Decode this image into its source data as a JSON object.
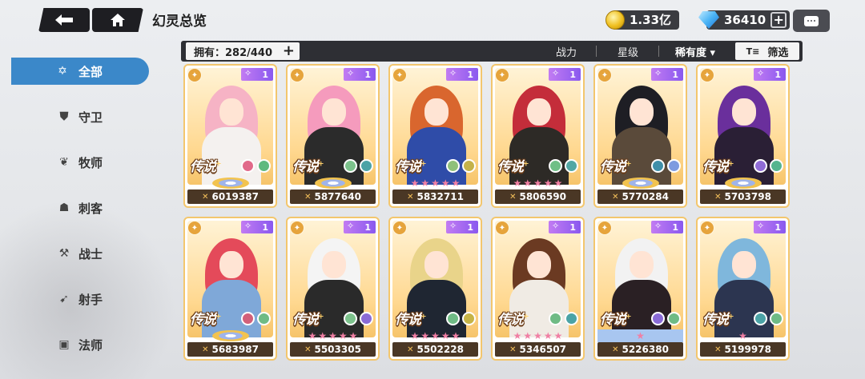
{
  "header": {
    "title": "幻灵总览",
    "back_icon": "back-arrow-icon",
    "home_icon": "home-icon",
    "gold": "1.33亿",
    "gems": "36410",
    "chat_icon": "chat-icon"
  },
  "sidebar": {
    "items": [
      {
        "label": "全部",
        "icon": "all-icon",
        "active": true
      },
      {
        "label": "守卫",
        "icon": "guard-icon"
      },
      {
        "label": "牧师",
        "icon": "priest-icon"
      },
      {
        "label": "刺客",
        "icon": "assassin-icon"
      },
      {
        "label": "战士",
        "icon": "warrior-icon"
      },
      {
        "label": "射手",
        "icon": "archer-icon"
      },
      {
        "label": "法师",
        "icon": "mage-icon"
      }
    ]
  },
  "filterbar": {
    "owned": "拥有：282/440",
    "sort_power": "战力",
    "sort_star": "星级",
    "sort_rarity": "稀有度 ▾",
    "filter_label": "筛选"
  },
  "cards": [
    {
      "level": "1",
      "rarity": "传说",
      "power": "6019387",
      "stars": "wings",
      "hair": "#f6b3c5",
      "body": "#f4f1ef"
    },
    {
      "level": "1",
      "rarity": "传说",
      "power": "5877640",
      "stars": "wings",
      "hair": "#f59bbd",
      "body": "#2b2b2b"
    },
    {
      "level": "1",
      "rarity": "传说",
      "power": "5832711",
      "stars": "5",
      "hair": "#d9662e",
      "body": "#2f4ca8"
    },
    {
      "level": "1",
      "rarity": "传说",
      "power": "5806590",
      "stars": "5",
      "hair": "#c42d3a",
      "body": "#2d2a26"
    },
    {
      "level": "1",
      "rarity": "传说",
      "power": "5770284",
      "stars": "wings",
      "hair": "#1e1e24",
      "body": "#5a4a3a"
    },
    {
      "level": "1",
      "rarity": "传说",
      "power": "5703798",
      "stars": "wings",
      "hair": "#6a2f9c",
      "body": "#2a1f35"
    },
    {
      "level": "1",
      "rarity": "传说",
      "power": "5683987",
      "stars": "wings",
      "hair": "#e44a5a",
      "body": "#7fa8d8"
    },
    {
      "level": "1",
      "rarity": "传说",
      "power": "5503305",
      "stars": "5",
      "hair": "#f4f4f4",
      "body": "#2a2a2a"
    },
    {
      "level": "1",
      "rarity": "传说",
      "power": "5502228",
      "stars": "5",
      "hair": "#e9d48a",
      "body": "#1f2632"
    },
    {
      "level": "1",
      "rarity": "传说",
      "power": "5346507",
      "stars": "5",
      "hair": "#6b3a22",
      "body": "#f0ebe4"
    },
    {
      "level": "1",
      "rarity": "传说",
      "power": "5226380",
      "stars": "1",
      "hair": "#f2f2f2",
      "body": "#2a2024"
    },
    {
      "level": "1",
      "rarity": "传说",
      "power": "5199978",
      "stars": "1",
      "hair": "#7fb7dc",
      "body": "#2c3550"
    }
  ],
  "colors": {
    "accent": "#3b88c9",
    "card_border": "#f3c66d",
    "power_bg": "#4a3725",
    "level_tag": "#8a59ef"
  }
}
